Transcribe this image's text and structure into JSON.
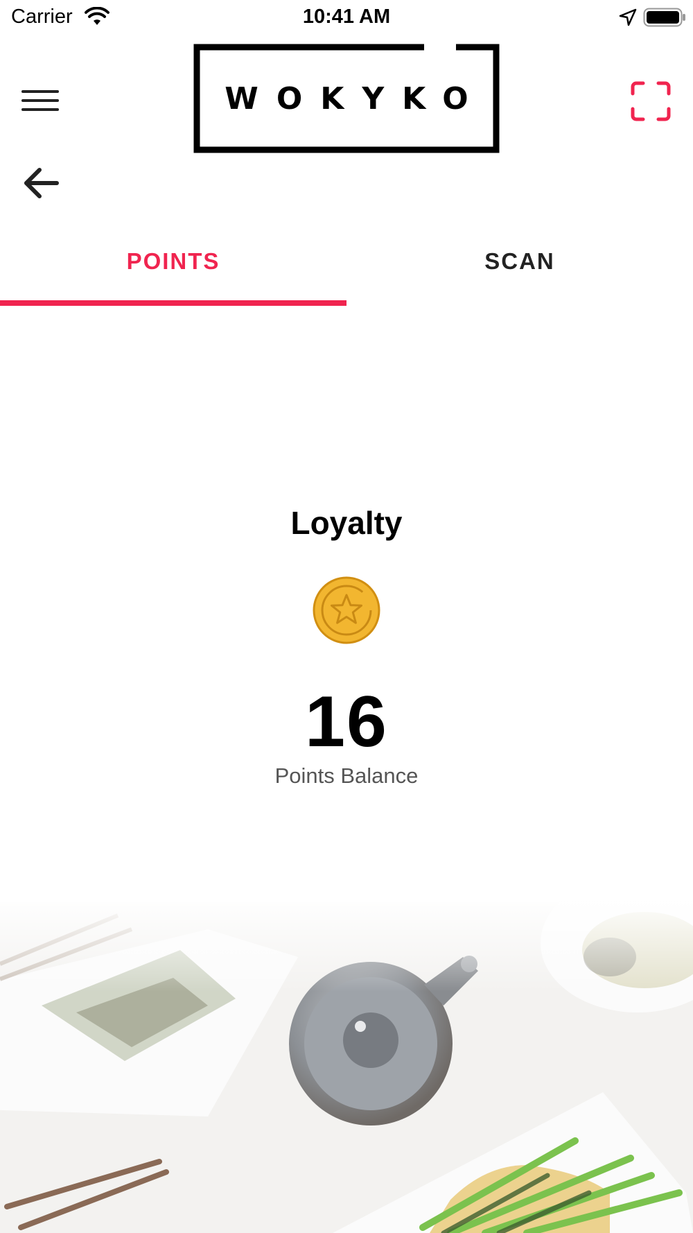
{
  "status_bar": {
    "carrier": "Carrier",
    "time": "10:41 AM"
  },
  "header": {
    "logo_text": "WOKYKO",
    "menu_icon": "hamburger-menu-icon",
    "scan_icon": "scan-frame-icon",
    "back_icon": "arrow-left-icon"
  },
  "tabs": [
    {
      "label": "POINTS",
      "active": true
    },
    {
      "label": "SCAN",
      "active": false
    }
  ],
  "loyalty": {
    "title": "Loyalty",
    "coin_icon": "star-coin-icon",
    "points_value": "16",
    "points_label": "Points Balance"
  },
  "colors": {
    "accent": "#f0244f",
    "coin": "#f2b630",
    "coin_stroke": "#d18f12"
  }
}
